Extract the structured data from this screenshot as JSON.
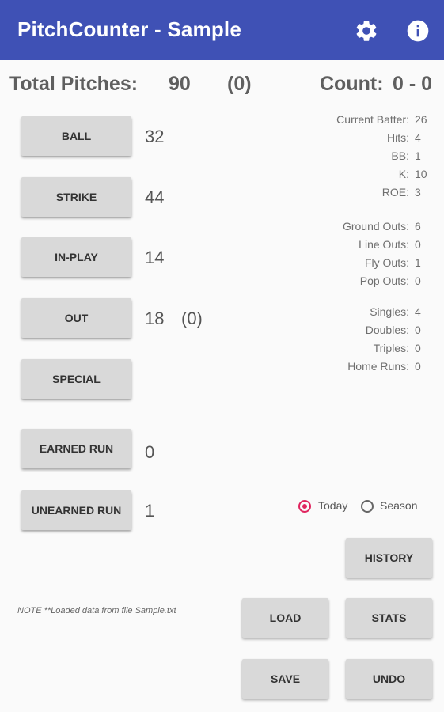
{
  "app": {
    "title": "PitchCounter - Sample"
  },
  "icons": {
    "settings": "gear-icon",
    "info": "info-icon"
  },
  "summary": {
    "total_label": "Total Pitches:",
    "total_value": "90",
    "total_paren": "(0)",
    "count_label": "Count:",
    "count_value": "0 - 0"
  },
  "buttons": {
    "ball": "BALL",
    "strike": "STRIKE",
    "in_play": "IN-PLAY",
    "out": "OUT",
    "special": "SPECIAL",
    "earned_run": "EARNED RUN",
    "unearned_run": "UNEARNED RUN",
    "history": "HISTORY",
    "load": "LOAD",
    "stats": "STATS",
    "save": "SAVE",
    "undo": "UNDO"
  },
  "counts": {
    "ball": "32",
    "strike": "44",
    "in_play": "14",
    "out": "18",
    "out_paren": "(0)",
    "earned_run": "0",
    "unearned_run": "1"
  },
  "stats": {
    "current_batter": {
      "label": "Current Batter:",
      "value": "26"
    },
    "hits": {
      "label": "Hits:",
      "value": "4"
    },
    "bb": {
      "label": "BB:",
      "value": "1"
    },
    "k": {
      "label": "K:",
      "value": "10"
    },
    "roe": {
      "label": "ROE:",
      "value": "3"
    },
    "ground_outs": {
      "label": "Ground Outs:",
      "value": "6"
    },
    "line_outs": {
      "label": "Line Outs:",
      "value": "0"
    },
    "fly_outs": {
      "label": "Fly Outs:",
      "value": "1"
    },
    "pop_outs": {
      "label": "Pop Outs:",
      "value": "0"
    },
    "singles": {
      "label": "Singles:",
      "value": "4"
    },
    "doubles": {
      "label": "Doubles:",
      "value": "0"
    },
    "triples": {
      "label": "Triples:",
      "value": "0"
    },
    "home_runs": {
      "label": "Home Runs:",
      "value": "0"
    }
  },
  "scope": {
    "today_label": "Today",
    "season_label": "Season",
    "selected": "Today"
  },
  "note": "NOTE **Loaded data from file Sample.txt",
  "colors": {
    "appbar": "#3f51b5",
    "radio_selected": "#e0245e",
    "button_bg": "#d9d9d9"
  }
}
